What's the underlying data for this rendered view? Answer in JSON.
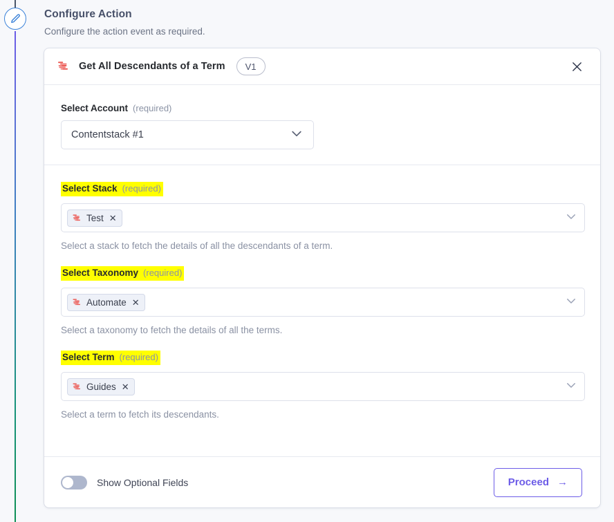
{
  "rail": {
    "icon": "pencil-edit-icon",
    "accent_top": "#6c5ce7",
    "accent_bottom": "#0d8f54"
  },
  "header": {
    "title": "Configure Action",
    "subtitle": "Configure the action event as required."
  },
  "card": {
    "logo_icon": "contentstack-logo-icon",
    "title": "Get All Descendants of a Term",
    "version": "V1",
    "close_icon": "close-icon",
    "account": {
      "label": "Select Account",
      "required": "(required)",
      "value": "Contentstack #1",
      "chevron_icon": "chevron-down-icon"
    },
    "fields": [
      {
        "label": "Select Stack",
        "required": "(required)",
        "highlighted": true,
        "chip": "Test",
        "chip_remove_icon": "close-small-icon",
        "helper": "Select a stack to fetch the details of all the descendants of a term.",
        "chevron_icon": "chevron-down-icon"
      },
      {
        "label": "Select Taxonomy",
        "required": "(required)",
        "highlighted": true,
        "chip": "Automate",
        "chip_remove_icon": "close-small-icon",
        "helper": "Select a taxonomy to fetch the details of all the terms.",
        "chevron_icon": "chevron-down-icon"
      },
      {
        "label": "Select Term",
        "required": "(required)",
        "highlighted": true,
        "chip": "Guides",
        "chip_remove_icon": "close-small-icon",
        "helper": "Select a term to fetch its descendants.",
        "chevron_icon": "chevron-down-icon"
      }
    ],
    "footer": {
      "toggle_label": "Show Optional Fields",
      "toggle_state": "off",
      "proceed_label": "Proceed",
      "proceed_arrow": "→"
    }
  },
  "colors": {
    "accent": "#6c5ce7",
    "highlight": "#ffff00",
    "brand_red": "#ec5b56",
    "page_bg": "#f7f8fb"
  }
}
